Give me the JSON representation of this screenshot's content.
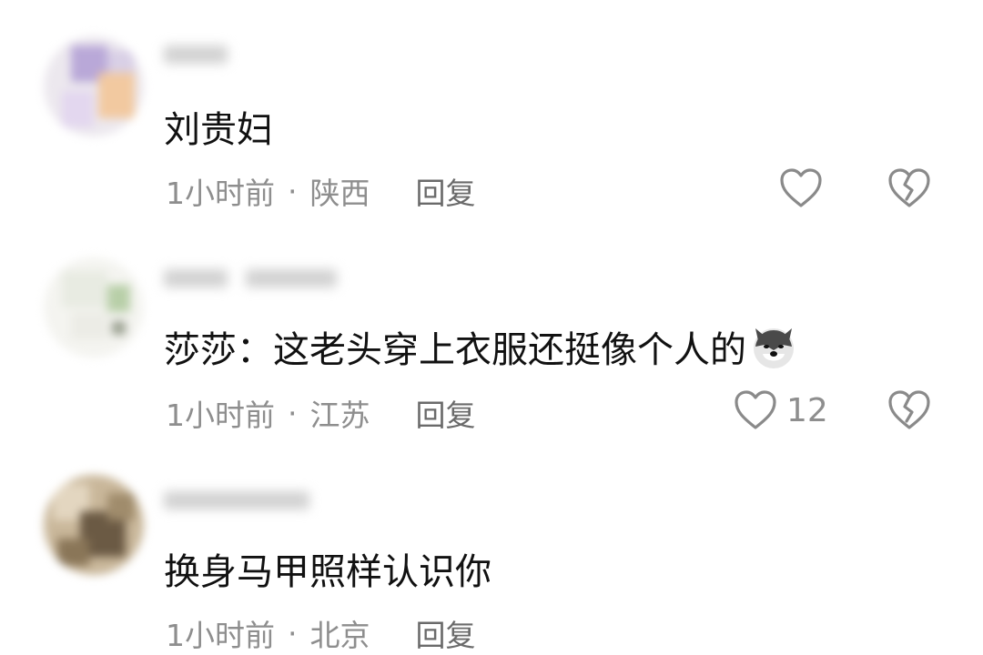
{
  "comments": [
    {
      "avatar_icon": "blurred-avatar",
      "text": "刘贵妇",
      "time": "1小时前",
      "separator": "·",
      "location": "陕西",
      "reply_label": "回复",
      "like_icon": "heart-outline-icon",
      "like_count": "",
      "dislike_icon": "broken-heart-icon"
    },
    {
      "avatar_icon": "blurred-avatar",
      "text": "莎莎：这老头穿上衣服还挺像个人的",
      "emoji": "husky-dog-emoji",
      "time": "1小时前",
      "separator": "·",
      "location": "江苏",
      "reply_label": "回复",
      "like_icon": "heart-outline-icon",
      "like_count": "12",
      "dislike_icon": "broken-heart-icon"
    },
    {
      "avatar_icon": "blurred-avatar",
      "text": "换身马甲照样认识你",
      "time": "1小时前",
      "separator": "·",
      "location": "北京",
      "reply_label": "回复",
      "like_icon": "heart-outline-icon",
      "like_count": "",
      "dislike_icon": "broken-heart-icon"
    }
  ]
}
